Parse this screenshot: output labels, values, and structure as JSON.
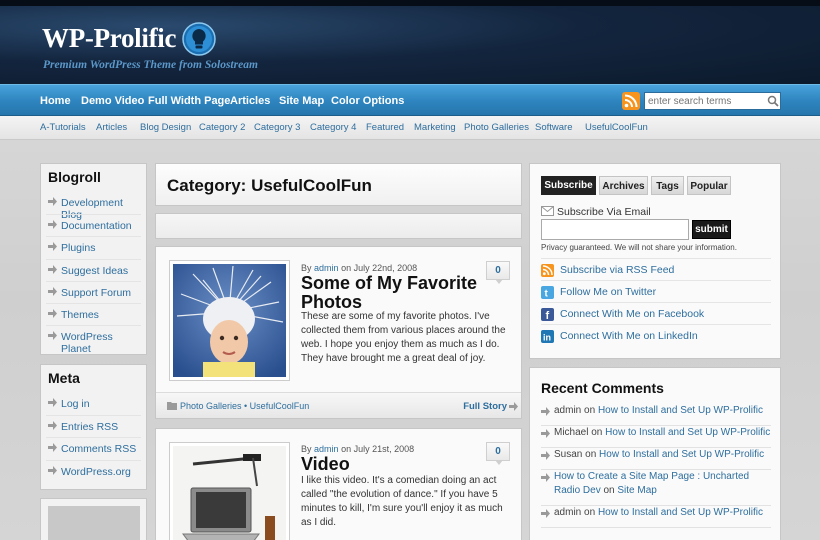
{
  "header": {
    "logo_text": "WP-Prolific",
    "tagline": "Premium WordPress Theme from Solostream"
  },
  "main_nav": [
    "Home",
    "Demo Video",
    "Full Width Page",
    "Articles",
    "Site Map",
    "Color Options"
  ],
  "search": {
    "placeholder": "enter search terms"
  },
  "sub_nav": [
    "A-Tutorials",
    "Articles",
    "Blog Design",
    "Category 2",
    "Category 3",
    "Category 4",
    "Featured",
    "Marketing",
    "Photo Galleries",
    "Software",
    "UsefulCoolFun"
  ],
  "blogroll": {
    "title": "Blogroll",
    "items": [
      "Development Blog",
      "Documentation",
      "Plugins",
      "Suggest Ideas",
      "Support Forum",
      "Themes",
      "WordPress Planet"
    ]
  },
  "meta": {
    "title": "Meta",
    "items": [
      "Log in",
      "Entries RSS",
      "Comments RSS",
      "WordPress.org"
    ]
  },
  "main": {
    "category_title": "Category: UsefulCoolFun",
    "posts": [
      {
        "meta_by": "By",
        "author": "admin",
        "date": "on July 22nd, 2008",
        "title": "Some of My Favorite Photos",
        "excerpt": "These are some of my favorite photos. I've collected them from various places around the web. I hope you enjoy them as much as I do. They have brought me a great deal of joy.",
        "comments": "0",
        "categories": "Photo Galleries • UsefulCoolFun",
        "full_story": "Full Story"
      },
      {
        "meta_by": "By",
        "author": "admin",
        "date": "on July 21st, 2008",
        "title": "Video",
        "excerpt": "I like this video. It's a comedian doing an act called \"the evolution of dance.\" If you have 5 minutes to kill, I'm sure you'll enjoy it as much as I did.",
        "comments": "0"
      }
    ]
  },
  "right": {
    "tabs": [
      "Subscribe",
      "Archives",
      "Tags",
      "Popular"
    ],
    "subscribe_email_label": "Subscribe Via Email",
    "submit_label": "submit",
    "privacy": "Privacy guaranteed. We will not share your information.",
    "social": [
      "Subscribe via RSS Feed",
      "Follow Me on Twitter",
      "Connect With Me on Facebook",
      "Connect With Me on LinkedIn"
    ],
    "recent_comments_title": "Recent Comments",
    "recent_comments": [
      {
        "who": "admin",
        "on": "on",
        "post": "How to Install and Set Up WP-Prolific"
      },
      {
        "who": "Michael",
        "on": "on",
        "post": "How to Install and Set Up WP-Prolific"
      },
      {
        "who": "Susan",
        "on": "on",
        "post": "How to Install and Set Up WP-Prolific"
      },
      {
        "who": "How to Create a Site Map Page : Uncharted Radio Dev",
        "on": "on",
        "post": "Site Map"
      },
      {
        "who": "admin",
        "on": "on",
        "post": "How to Install and Set Up WP-Prolific"
      }
    ]
  },
  "colors": {
    "accent_blue": "#2e86c1",
    "link": "#2e6e9e",
    "header_dark": "#0c1a2c",
    "rss_orange": "#f7941d"
  }
}
